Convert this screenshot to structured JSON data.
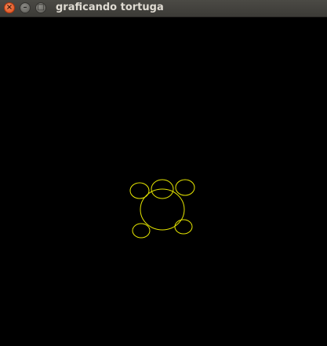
{
  "window": {
    "title": "graficando tortuga",
    "close_glyph": "×",
    "minimize_glyph": "–",
    "maximize_glyph": "□"
  },
  "drawing": {
    "background_color": "#000000",
    "stroke_color": "#e6e600",
    "shape": "turtle-outline"
  }
}
